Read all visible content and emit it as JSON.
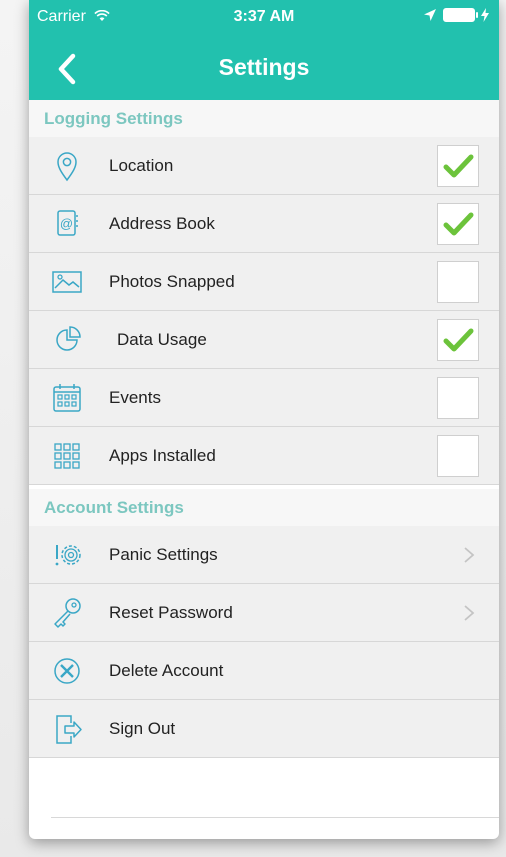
{
  "status_bar": {
    "carrier": "Carrier",
    "time": "3:37 AM"
  },
  "nav": {
    "title": "Settings"
  },
  "sections": [
    {
      "title": "Logging Settings",
      "items": [
        {
          "label": "Location",
          "icon": "location-pin-icon",
          "checked": true
        },
        {
          "label": "Address Book",
          "icon": "address-book-icon",
          "checked": true
        },
        {
          "label": "Photos Snapped",
          "icon": "photo-icon",
          "checked": false
        },
        {
          "label": "Data Usage",
          "icon": "pie-chart-icon",
          "checked": true
        },
        {
          "label": "Events",
          "icon": "calendar-icon",
          "checked": false
        },
        {
          "label": "Apps Installed",
          "icon": "app-grid-icon",
          "checked": false
        }
      ]
    },
    {
      "title": "Account Settings",
      "items": [
        {
          "label": "Panic Settings",
          "icon": "panic-gear-icon",
          "chevron": true
        },
        {
          "label": "Reset Password",
          "icon": "key-icon",
          "chevron": true
        },
        {
          "label": "Delete Account",
          "icon": "delete-x-icon",
          "chevron": false
        },
        {
          "label": "Sign Out",
          "icon": "sign-out-icon",
          "chevron": false
        }
      ]
    }
  ],
  "colors": {
    "accent": "#22c1ae",
    "section_text": "#7cc7c0",
    "check": "#6cc33b",
    "row_bg": "#f0f0f0"
  }
}
